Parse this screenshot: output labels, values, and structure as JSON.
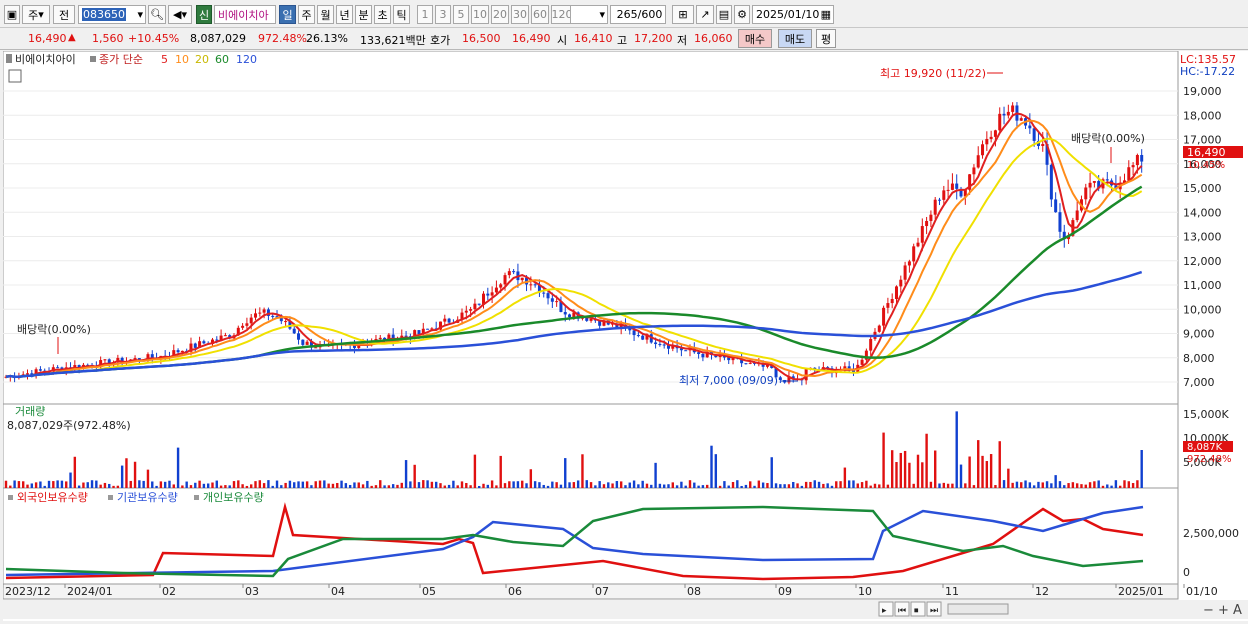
{
  "toolbar": {
    "market": "주",
    "prev_btn": "전",
    "stock_code": "083650",
    "stock_tag": "신",
    "stock_name": "비에이치아",
    "periods": [
      "일",
      "주",
      "월",
      "년",
      "분",
      "초",
      "틱"
    ],
    "active_period": "일",
    "intervals": [
      "1",
      "3",
      "5",
      "10",
      "20",
      "30",
      "60",
      "120"
    ],
    "count": "265",
    "count_total": "/600",
    "date": "2025/01/10"
  },
  "quote": {
    "price": "16,490",
    "arrow": "▲",
    "change": "1,560",
    "change_pct": "+10.45%",
    "volume": "8,087,029",
    "volume_ratio": "972.48%",
    "turnover": "26.13%",
    "amount": "133,621백만",
    "hoga_label": "호가",
    "ask": "16,500",
    "bid": "16,490",
    "open_label": "시",
    "open": "16,410",
    "high_label": "고",
    "high": "17,200",
    "low_label": "저",
    "low": "16,060",
    "buy_label": "매수",
    "sell_label": "매도",
    "avg_label": "평"
  },
  "price_panel": {
    "stock_name": "비에이치아이",
    "ma_label": "종가 단순",
    "ma_periods": [
      "5",
      "10",
      "20",
      "60",
      "120"
    ],
    "ma_colors": [
      "#e02020",
      "#ff8c1a",
      "#f0e000",
      "#1a8a2a",
      "#2a50d8"
    ],
    "lc": "LC:135.57",
    "hc": "HC:-17.22",
    "high_annot": "최고 19,920 (11/22)",
    "low_annot": "최저 7,000 (09/09)",
    "div_annot_left": "배당락(0.00%)",
    "div_annot_right": "배당락(0.00%)",
    "last_price": "16,490",
    "last_pct": "10.45%",
    "y_ticks": [
      "19,000",
      "18,000",
      "17,000",
      "16,000",
      "15,000",
      "14,000",
      "13,000",
      "12,000",
      "11,000",
      "10,000",
      "9,000",
      "8,000",
      "7,000"
    ]
  },
  "volume_panel": {
    "title": "거래량",
    "value": "8,087,029주(972.48%)",
    "y_ticks": [
      "15,000K",
      "10,000K",
      "5,000K"
    ],
    "last_value": "8,087K",
    "last_pct": "972.48%"
  },
  "holding_panel": {
    "series": [
      "외국인보유수량",
      "기관보유수량",
      "개인보유수량"
    ],
    "series_colors": [
      "#e01010",
      "#2a50d8",
      "#1a8a3a"
    ],
    "y_ticks": [
      "2,500,000",
      "0"
    ]
  },
  "x_axis": {
    "labels": [
      "2023/12",
      "2024/01",
      "02",
      "03",
      "04",
      "05",
      "06",
      "07",
      "08",
      "09",
      "10",
      "11",
      "12",
      "2025/01",
      "01/10"
    ]
  },
  "chart_data": {
    "type": "candlestick",
    "title": "비에이치아이",
    "period": "daily",
    "y_range": [
      6500,
      19920
    ],
    "annotations": {
      "high": {
        "value": 19920,
        "date": "11/22"
      },
      "low": {
        "value": 7000,
        "date": "09/09"
      },
      "last": 16490
    },
    "close_monthly": [
      {
        "month": "2023/12",
        "close": 7300
      },
      {
        "month": "2024/01",
        "close": 8100
      },
      {
        "month": "02",
        "close": 8000
      },
      {
        "month": "03",
        "close": 10200
      },
      {
        "month": "04",
        "close": 8400
      },
      {
        "month": "05",
        "close": 9500
      },
      {
        "month": "06",
        "close": 10300
      },
      {
        "month": "07",
        "close": 8900
      },
      {
        "month": "08",
        "close": 7900
      },
      {
        "month": "09",
        "close": 7800
      },
      {
        "month": "10",
        "close": 8800
      },
      {
        "month": "11",
        "close": 17500
      },
      {
        "month": "12",
        "close": 14800
      },
      {
        "month": "2025/01",
        "close": 16490
      }
    ]
  }
}
